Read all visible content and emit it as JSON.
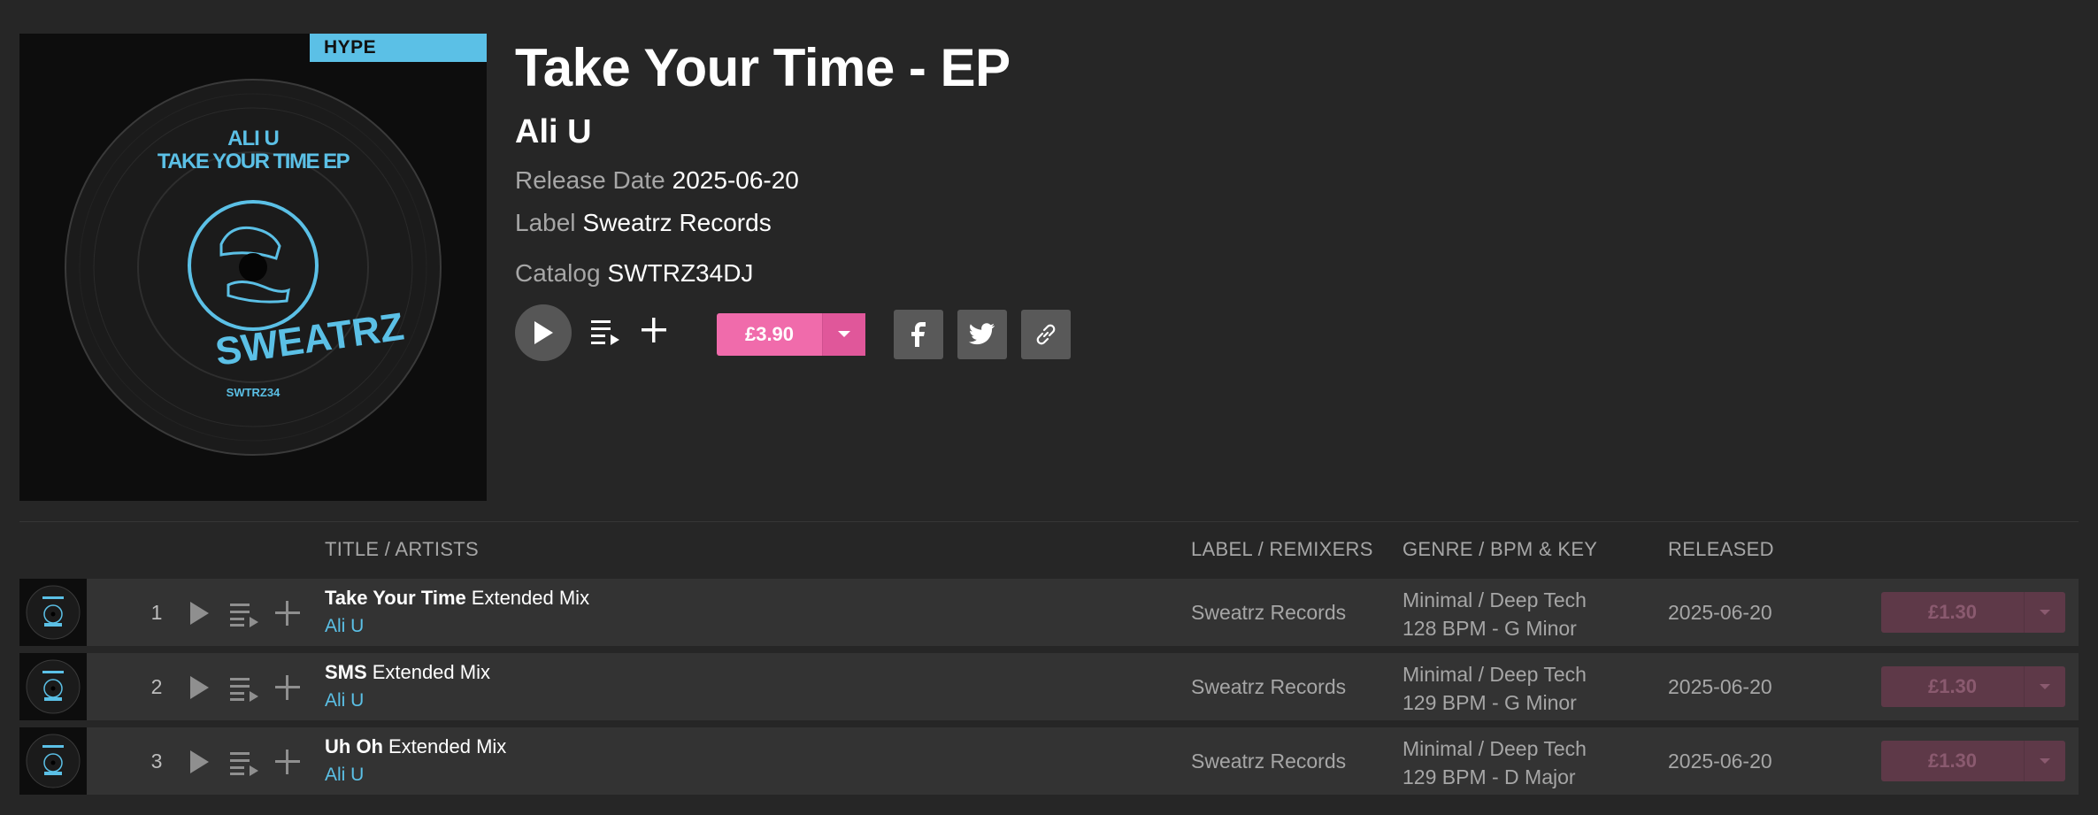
{
  "release": {
    "badge": "HYPE",
    "cover_artist": "ALI U",
    "cover_title": "TAKE YOUR TIME EP",
    "cover_brand": "SWEATRZ",
    "cover_catalog": "SWTRZ34",
    "title": "Take Your Time - EP",
    "artist": "Ali U",
    "release_date_label": "Release Date",
    "release_date": "2025-06-20",
    "label_label": "Label",
    "label": "Sweatrz Records",
    "catalog_label": "Catalog",
    "catalog": "SWTRZ34DJ",
    "price": "£3.90"
  },
  "colors": {
    "background": "#262626",
    "accent_pink": "#f06bab",
    "accent_blue": "#5bc0e6",
    "row_bg": "#333333"
  },
  "icons": {
    "play": "play-icon",
    "queue": "queue-icon",
    "add": "plus-icon",
    "dropdown": "chevron-down-icon",
    "facebook": "facebook-icon",
    "twitter": "twitter-icon",
    "link": "link-icon"
  },
  "tracklist": {
    "headers": {
      "title": "TITLE / ARTISTS",
      "label": "LABEL / REMIXERS",
      "genre": "GENRE / BPM & KEY",
      "released": "RELEASED"
    },
    "tracks": [
      {
        "num": "1",
        "title": "Take Your Time",
        "mix": "Extended Mix",
        "artist": "Ali U",
        "label": "Sweatrz Records",
        "genre": "Minimal / Deep Tech",
        "bpm_key": "128 BPM - G Minor",
        "released": "2025-06-20",
        "price": "£1.30"
      },
      {
        "num": "2",
        "title": "SMS",
        "mix": "Extended Mix",
        "artist": "Ali U",
        "label": "Sweatrz Records",
        "genre": "Minimal / Deep Tech",
        "bpm_key": "129 BPM - G Minor",
        "released": "2025-06-20",
        "price": "£1.30"
      },
      {
        "num": "3",
        "title": "Uh Oh",
        "mix": "Extended Mix",
        "artist": "Ali U",
        "label": "Sweatrz Records",
        "genre": "Minimal / Deep Tech",
        "bpm_key": "129 BPM - D Major",
        "released": "2025-06-20",
        "price": "£1.30"
      }
    ]
  }
}
